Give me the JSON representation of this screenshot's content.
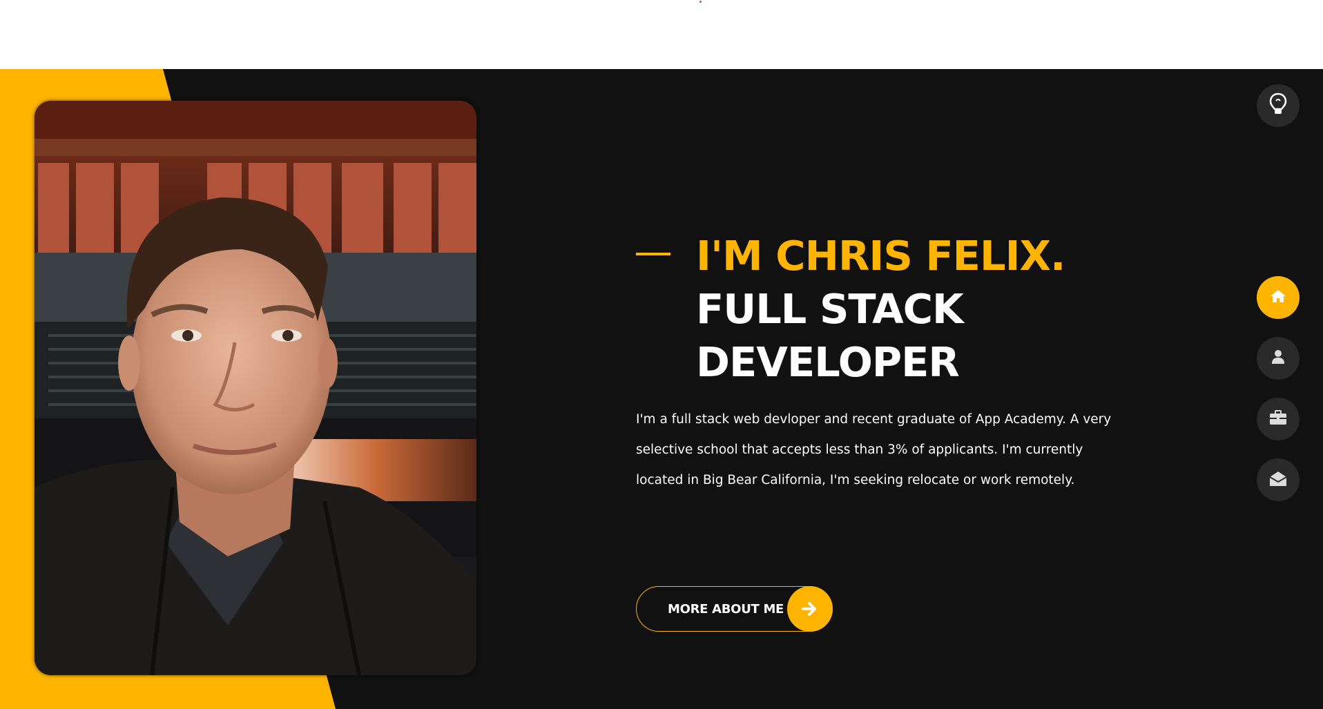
{
  "hero": {
    "title_name": "I'M CHRIS FELIX.",
    "title_role": "FULL STACK DEVELOPER",
    "bio": "I'm a full stack web devloper and recent graduate of App Academy. A very selective school that accepts less than 3% of applicants. I'm currently located in Big Bear California, I'm seeking relocate or work remotely.",
    "cta_label": "MORE ABOUT ME"
  },
  "nav": {
    "items": [
      {
        "name": "home",
        "icon": "home-icon",
        "active": true
      },
      {
        "name": "about",
        "icon": "user-icon",
        "active": false
      },
      {
        "name": "portfolio",
        "icon": "briefcase-icon",
        "active": false
      },
      {
        "name": "contact",
        "icon": "envelope-open-icon",
        "active": false
      }
    ],
    "theme_toggle_icon": "lightbulb-icon"
  },
  "colors": {
    "accent": "#ffb400",
    "background": "#111111",
    "nav_button": "#2b2a2a",
    "text": "#ffffff"
  }
}
